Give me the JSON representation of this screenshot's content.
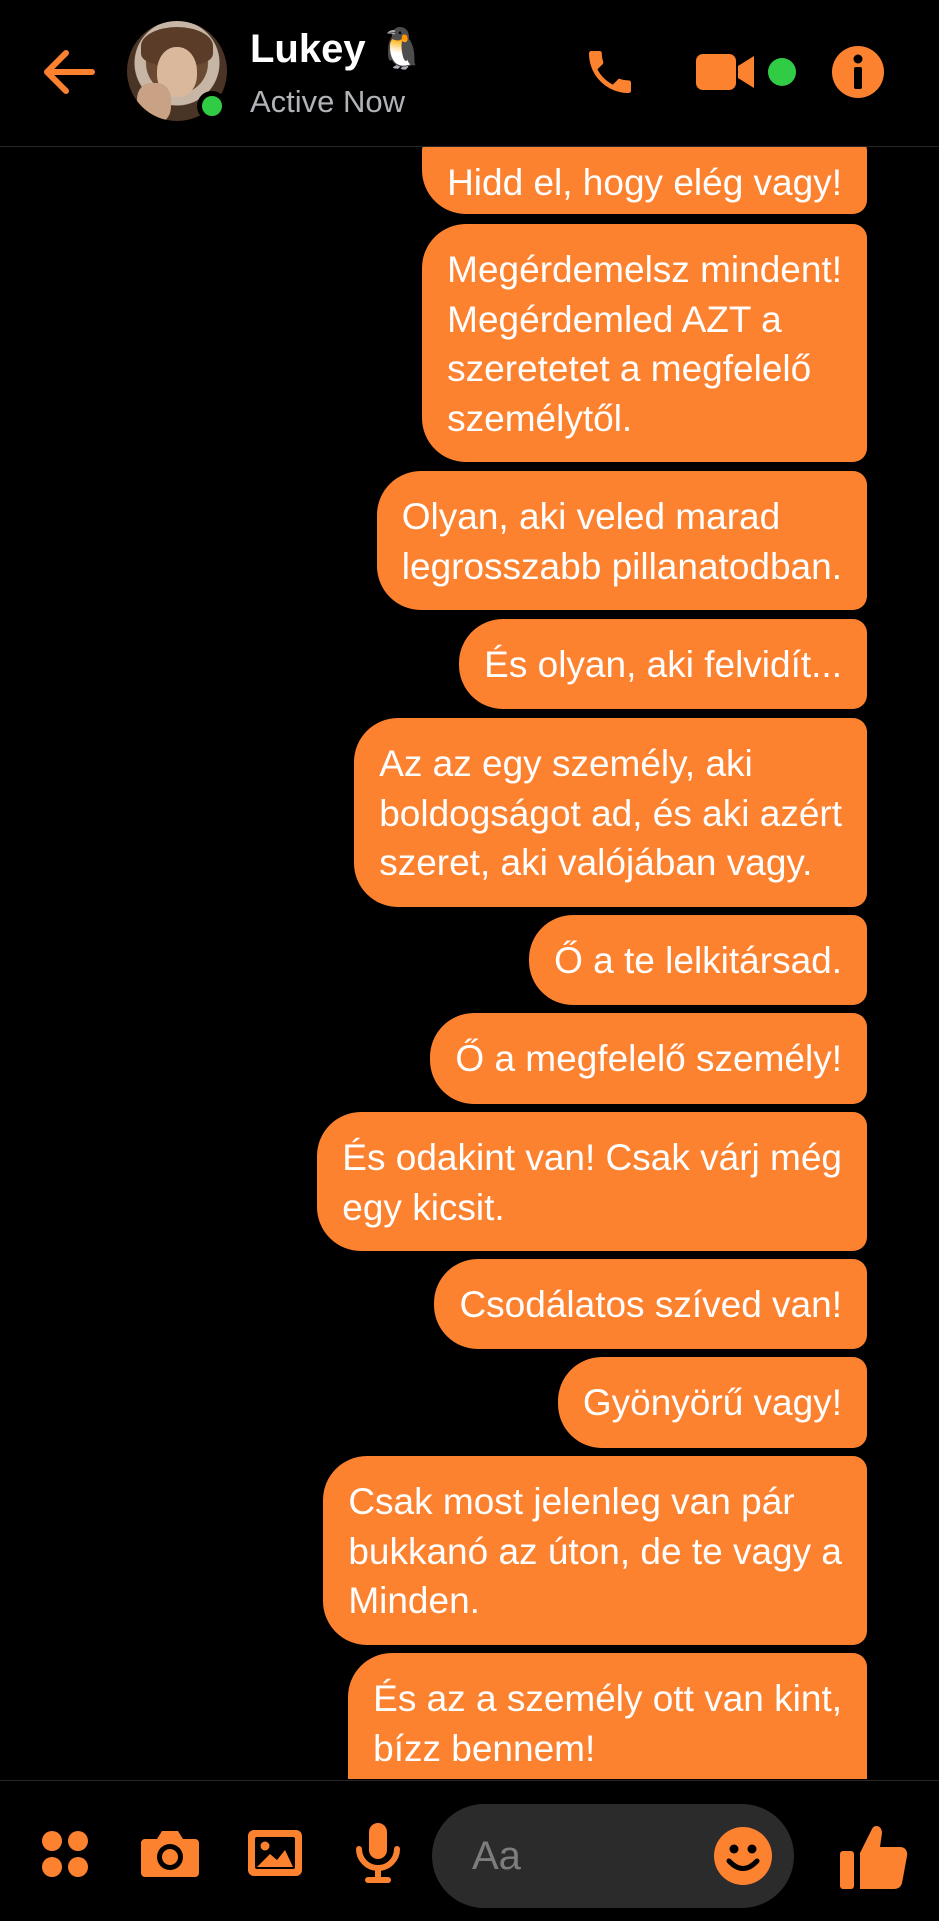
{
  "header": {
    "contact_name": "Lukey 🐧",
    "status": "Active Now",
    "accent_color": "#fd8230",
    "online_color": "#31cc46",
    "icons": [
      "back-arrow-icon",
      "avatar",
      "phone-icon",
      "video-camera-icon",
      "info-icon"
    ]
  },
  "messages": [
    "Hidd el, hogy elég vagy!",
    "Megérdemelsz mindent!\nMegérdemled AZT a\nszeretetet a megfelelő\nszemélytől.",
    "Olyan, aki veled marad\nlegrosszabb pillanatodban.",
    "És olyan, aki felvidít...",
    "Az az egy személy, aki\nboldogságot ad, és aki azért\nszeret, aki valójában vagy.",
    "Ő a te lelkitársad.",
    "Ő a megfelelő személy!",
    "És odakint van! Csak várj még\negy kicsit.",
    "Csodálatos szíved van!",
    "Gyönyörű vagy!",
    "Csak most jelenleg van pár\nbukkanó az úton, de te vagy a\nMinden.",
    "És az a személy ott van kint,\nbízz bennem!"
  ],
  "composer": {
    "placeholder": "Aa",
    "icons": [
      "apps-menu-icon",
      "camera-icon",
      "gallery-icon",
      "microphone-icon",
      "emoji-icon",
      "thumbs-up-icon"
    ]
  },
  "colors": {
    "background": "#000000",
    "bubble": "#fd8230",
    "input_background": "#2b2b2b",
    "secondary_text": "#b0b3b8"
  }
}
